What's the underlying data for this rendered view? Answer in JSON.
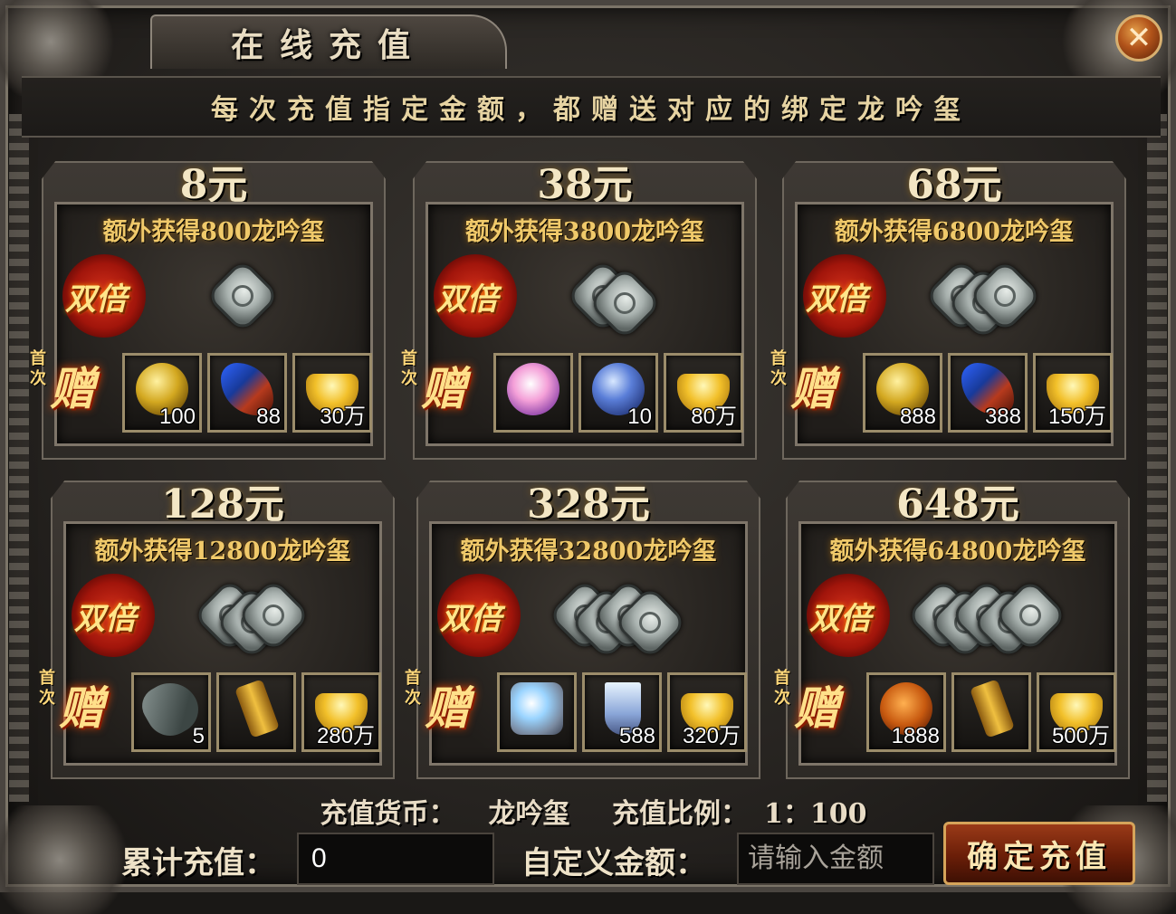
{
  "title": "在线充值",
  "close_label": "✕",
  "banner": "每次充值指定金额，都赠送对应的绑定龙吟玺",
  "double_label": "双倍",
  "gift_small": "首次",
  "gift_big": "赠",
  "packages": [
    {
      "price": "8元",
      "bonus": "额外获得800龙吟玺",
      "seal_count": 1,
      "items": [
        {
          "icon": "gold-coin-icon",
          "qty": "100"
        },
        {
          "icon": "red-gem-icon",
          "qty": "88"
        },
        {
          "icon": "gold-ingot-icon",
          "qty": "30万"
        }
      ]
    },
    {
      "price": "38元",
      "bonus": "额外获得3800龙吟玺",
      "seal_count": 2,
      "items": [
        {
          "icon": "pink-orb-icon",
          "qty": ""
        },
        {
          "icon": "blue-orb-icon",
          "qty": "10"
        },
        {
          "icon": "gold-ingot-icon",
          "qty": "80万"
        }
      ]
    },
    {
      "price": "68元",
      "bonus": "额外获得6800龙吟玺",
      "seal_count": 3,
      "items": [
        {
          "icon": "gold-coin-icon",
          "qty": "888"
        },
        {
          "icon": "red-gem-icon",
          "qty": "388"
        },
        {
          "icon": "gold-ingot-icon",
          "qty": "150万"
        }
      ]
    },
    {
      "price": "128元",
      "bonus": "额外获得12800龙吟玺",
      "seal_count": 3,
      "items": [
        {
          "icon": "stone-icon",
          "qty": "5"
        },
        {
          "icon": "scroll-icon",
          "qty": ""
        },
        {
          "icon": "gold-ingot-icon",
          "qty": "280万"
        }
      ]
    },
    {
      "price": "328元",
      "bonus": "额外获得32800龙吟玺",
      "seal_count": 4,
      "items": [
        {
          "icon": "crystal-wand-icon",
          "qty": ""
        },
        {
          "icon": "ice-crystal-icon",
          "qty": "588"
        },
        {
          "icon": "gold-ingot-icon",
          "qty": "320万"
        }
      ]
    },
    {
      "price": "648元",
      "bonus": "额外获得64800龙吟玺",
      "seal_count": 5,
      "items": [
        {
          "icon": "dragon-coin-icon",
          "qty": "1888"
        },
        {
          "icon": "scroll-icon",
          "qty": ""
        },
        {
          "icon": "gold-ingot-icon",
          "qty": "500万"
        }
      ]
    }
  ],
  "footer": {
    "currency_label": "充值货币：",
    "currency_value": "龙吟玺",
    "ratio_label": "充值比例：",
    "ratio_value": "1：100",
    "total_label": "累计充值：",
    "total_value": "0",
    "custom_label": "自定义金额：",
    "custom_placeholder": "请输入金额",
    "confirm_label": "确定充值"
  }
}
